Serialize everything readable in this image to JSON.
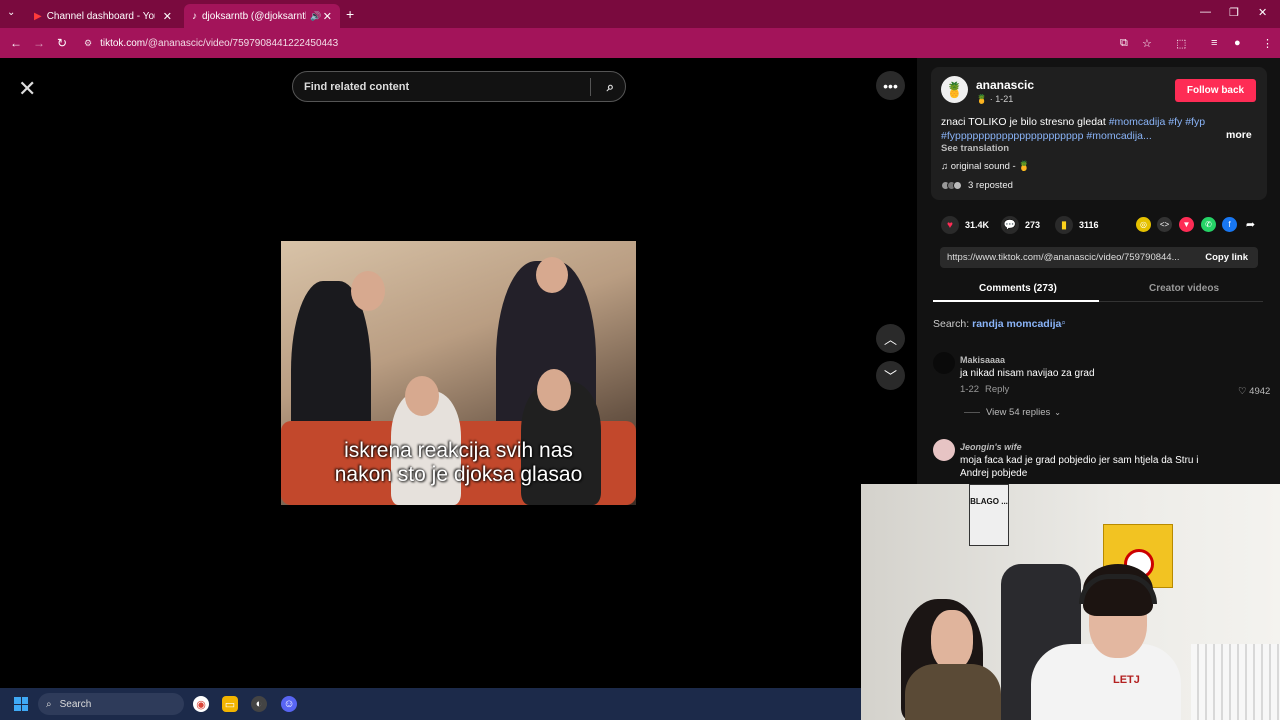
{
  "browser": {
    "tabs": [
      {
        "label": "Channel dashboard - YouTube S",
        "active": false
      },
      {
        "label": "djoksarntb (@djoksarntb) |",
        "active": true
      }
    ],
    "new_tab": "+",
    "url_host": "tiktok.com",
    "url_path": "/@ananascic/video/7597908441222450443",
    "window_controls": [
      "—",
      "❐",
      "✕"
    ]
  },
  "player": {
    "search_placeholder": "Find related content",
    "caption_line1": "iskrena reakcija svih nas",
    "caption_line2": "nakon sto je djoksa glasao"
  },
  "author": {
    "name": "ananascic",
    "sub": "🍍 · 1-21",
    "follow_label": "Follow back",
    "avatar_emoji": "🍍"
  },
  "description": {
    "text": "znaci TOLIKO je bilo stresno gledat",
    "tags": [
      "#momcadija",
      "#fy",
      "#fyp",
      "#fypppppppppppppppppppppp",
      "#momcadija..."
    ],
    "more_label": "more",
    "see_translation": "See translation",
    "sound": "♫  original sound - 🍍",
    "reposted": "3 reposted"
  },
  "stats": {
    "likes": "31.4K",
    "comments": "273",
    "saves": "3116"
  },
  "link": {
    "url": "https://www.tiktok.com/@ananascic/video/759790844...",
    "copy_label": "Copy link"
  },
  "panel_tabs": {
    "comments": "Comments (273)",
    "creator": "Creator videos"
  },
  "search_suggestion": {
    "prefix": "Search: ",
    "query": "randja momcadija"
  },
  "comments": [
    {
      "name": "Makisaaaa",
      "text": "ja nikad nisam navijao za grad",
      "date": "1-22",
      "reply_label": "Reply",
      "likes": "4942",
      "view_replies": "View 54 replies"
    },
    {
      "name": "Jeongin's wife",
      "text_line1": "moja faca kad je grad pobjedio jer sam htjela da Stru i",
      "text_line2": "Andrej pobjede"
    }
  ],
  "webcam": {
    "poster_text": "BLAGO ...",
    "shirt_text": "LETJ"
  },
  "taskbar": {
    "search_label": "Search"
  },
  "colors": {
    "tab_bar": "#7a0a3e",
    "address_bar": "#a3145a",
    "follow_button": "#fe2c55",
    "hashtag": "#8ab4f8"
  }
}
